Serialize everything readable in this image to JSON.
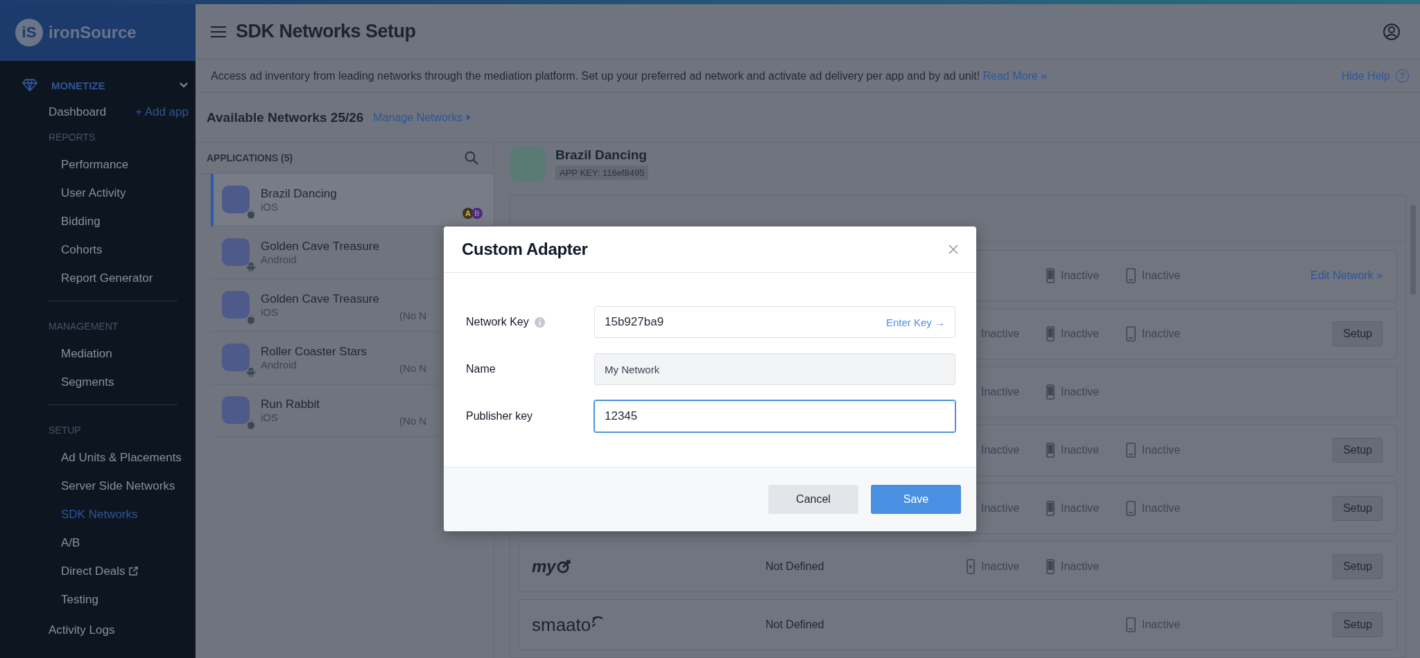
{
  "sidebar": {
    "logo_mark": "iS",
    "logo": "ironSource",
    "section": {
      "label": "MONETIZE",
      "expanded": true
    },
    "dashboard": "Dashboard",
    "add_app": "+ Add app",
    "groups": [
      {
        "label": "REPORTS",
        "items": [
          {
            "label": "Performance",
            "selected": false,
            "external": false
          },
          {
            "label": "User Activity",
            "selected": false,
            "external": false
          },
          {
            "label": "Bidding",
            "selected": false,
            "external": false
          },
          {
            "label": "Cohorts",
            "selected": false,
            "external": false
          },
          {
            "label": "Report Generator",
            "selected": false,
            "external": false
          }
        ]
      },
      {
        "label": "MANAGEMENT",
        "items": [
          {
            "label": "Mediation",
            "selected": false,
            "external": false
          },
          {
            "label": "Segments",
            "selected": false,
            "external": false
          }
        ]
      },
      {
        "label": "SETUP",
        "items": [
          {
            "label": "Ad Units & Placements",
            "selected": false,
            "external": false
          },
          {
            "label": "Server Side Networks",
            "selected": false,
            "external": false
          },
          {
            "label": "SDK Networks",
            "selected": true,
            "external": false
          },
          {
            "label": "A/B",
            "selected": false,
            "external": false
          },
          {
            "label": "Direct Deals",
            "selected": false,
            "external": true
          },
          {
            "label": "Testing",
            "selected": false,
            "external": false
          }
        ]
      }
    ],
    "footer_item": "Activity Logs"
  },
  "header": {
    "title": "SDK Networks Setup",
    "help_text": "Access ad inventory from leading networks through the mediation platform. Set up your preferred ad network and activate ad delivery per app and by ad unit!",
    "read_more": "Read More »",
    "hide_help": "Hide Help",
    "help_mark": "?"
  },
  "networks_bar": {
    "title": "Available Networks 25/26",
    "manage": "Manage Networks"
  },
  "applications": {
    "title": "APPLICATIONS (5)",
    "items": [
      {
        "name": "Brazil Dancing",
        "platform": "iOS",
        "kind": "ios",
        "selected": true,
        "badges": [
          "A",
          "B"
        ]
      },
      {
        "name": "Golden Cave Treasure",
        "platform": "Android",
        "kind": "android",
        "selected": false
      },
      {
        "name": "Golden Cave Treasure",
        "platform": "iOS",
        "kind": "ios",
        "selected": false,
        "note": "(No N"
      },
      {
        "name": "Roller Coaster Stars",
        "platform": "Android",
        "kind": "android",
        "selected": false,
        "note": "(No N"
      },
      {
        "name": "Run Rabbit",
        "platform": "iOS",
        "kind": "ios",
        "selected": false,
        "note": "(No N"
      }
    ]
  },
  "app_header": {
    "name": "Brazil Dancing",
    "app_key": "APP KEY: 116ef8495"
  },
  "networks": [
    {
      "slots": [
        {
          "kind": "phone",
          "label": "Inactive"
        },
        {
          "kind": "tablet",
          "label": "Inactive"
        }
      ],
      "action": {
        "kind": "link",
        "label": "Edit Network »"
      }
    },
    {
      "slots": [
        {
          "kind": "video",
          "label": "Inactive"
        },
        {
          "kind": "phone",
          "label": "Inactive"
        },
        {
          "kind": "tablet",
          "label": "Inactive"
        }
      ],
      "action": {
        "kind": "button",
        "label": "Setup"
      }
    },
    {
      "slots": [
        {
          "kind": "video",
          "label": "Inactive"
        },
        {
          "kind": "phone",
          "label": "Inactive"
        }
      ]
    },
    {
      "slots": [
        {
          "kind": "video",
          "label": "Inactive"
        },
        {
          "kind": "phone",
          "label": "Inactive"
        },
        {
          "kind": "tablet",
          "label": "Inactive"
        }
      ],
      "action": {
        "kind": "button",
        "label": "Setup"
      }
    },
    {
      "slots": [
        {
          "kind": "video",
          "label": "Inactive"
        },
        {
          "kind": "phone",
          "label": "Inactive"
        },
        {
          "kind": "tablet",
          "label": "Inactive"
        }
      ],
      "action": {
        "kind": "button",
        "label": "Setup"
      }
    },
    {
      "logo": {
        "kind": "target",
        "text": "my"
      },
      "status": "Not Defined",
      "slots": [
        {
          "kind": "video",
          "label": "Inactive"
        },
        {
          "kind": "phone",
          "label": "Inactive"
        }
      ],
      "action": {
        "kind": "button",
        "label": "Setup"
      }
    },
    {
      "logo": {
        "kind": "signal",
        "text": "smaato"
      },
      "status": "Not Defined",
      "slots": [
        {
          "kind": "tablet",
          "label": "Inactive"
        }
      ],
      "action": {
        "kind": "button",
        "label": "Setup"
      }
    }
  ],
  "modal": {
    "title": "Custom Adapter",
    "fields": [
      {
        "label": "Network Key",
        "info": true,
        "value": "15b927ba9",
        "kind": "key",
        "focused": false,
        "action": "Enter Key →"
      },
      {
        "label": "Name",
        "info": false,
        "value": "My Network",
        "kind": "readonly",
        "focused": false
      },
      {
        "label": "Publisher key",
        "info": false,
        "value": "12345",
        "kind": "text",
        "focused": true
      }
    ],
    "buttons": [
      {
        "label": "Cancel",
        "kind": "secondary"
      },
      {
        "label": "Save",
        "kind": "primary"
      }
    ]
  }
}
